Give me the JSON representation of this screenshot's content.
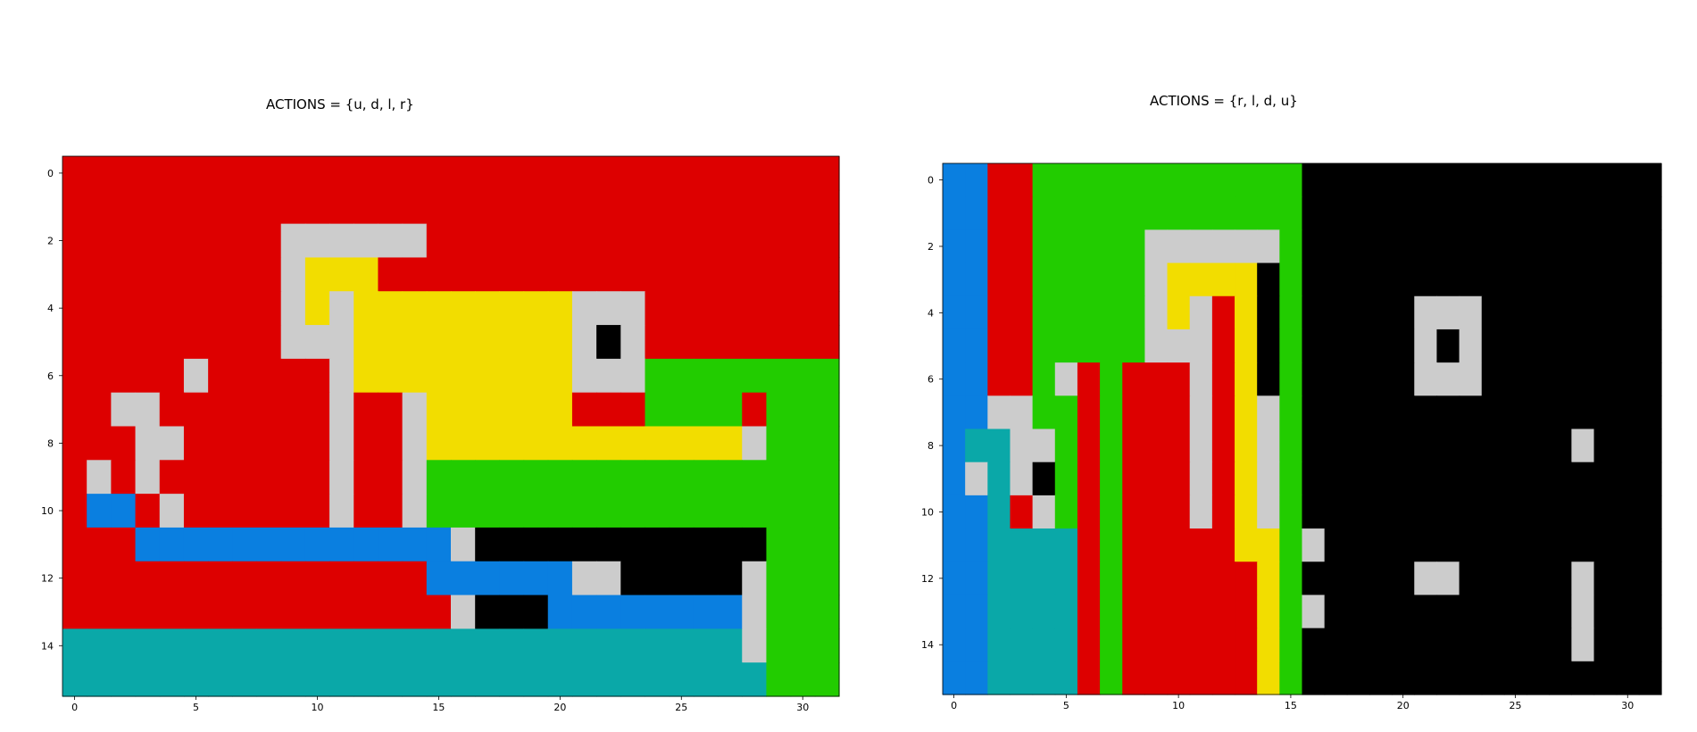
{
  "chart_data": [
    {
      "type": "heatmap",
      "title": "ACTIONS = {u, d, l, r}",
      "grid_shape": [
        16,
        32
      ],
      "xticks": [
        "0",
        "5",
        "10",
        "15",
        "20",
        "25",
        "30"
      ],
      "yticks": [
        "0",
        "2",
        "4",
        "6",
        "8",
        "10",
        "12",
        "14"
      ],
      "grid_rows": [
        "RRRRRRRRRRRRRRRRRRRRRRRRRRRRRRRR",
        "RRRRRRRRRRRRRRRRRRRRRRRRRRRRRRRR",
        "RRRRRRRRRWWWWWWRRRRRRRRRRRRRRRRR",
        "RRRRRRRRRWYYYRRRRRRRRRRRRRRRRRRR",
        "RRRRRRRRRWYWYYYYYYYYYWWWRRRRRRRR",
        "RRRRRRRRRWWWYYYYYYYYYWKWRRRRRRRR",
        "RRRRRWRRRRRWYYYYYYYYYWWWGGGGGGGG",
        "RRWWRRRRRRRWRRWYYYYYYRRRGGGGRGGG",
        "RRRWWRRRRRRWRRWYYYYYYYYYYYYYWGGG",
        "RWRWRRRRRRRWRRWGGGGGGGGGGGGGGGGG",
        "RBBRWRRRRRRWRRWGGGGGGGGGGGGGGGGG",
        "RRRBBBBBBBBBBBBBWKKKKKKKKKKKKGGG",
        "RRRRRRRRRRRRRRRBBBBBBWWKKKKKWGGG",
        "RRRRRRRRRRRRRRRRWKKKBBBBBBBBWGGG",
        "TTTTTTTTTTTTTTTTTTTTTTTTTTTTWGGG",
        "TTTTTTTTTTTTTTTTTTTTTTTTTTTTTGGG"
      ]
    },
    {
      "type": "heatmap",
      "title": "ACTIONS = {r, l, d, u}",
      "grid_shape": [
        16,
        32
      ],
      "xticks": [
        "0",
        "5",
        "10",
        "15",
        "20",
        "25",
        "30"
      ],
      "yticks": [
        "0",
        "2",
        "4",
        "6",
        "8",
        "10",
        "12",
        "14"
      ],
      "grid_rows": [
        "BBRRGGGGGGGGGGGGKKKKKKKKKKKKKKKK",
        "BBRRGGGGGGGGGGGGKKKKKKKKKKKKKKKK",
        "BBRRGGGGGWWWWWWGKKKKKKKKKKKKKKKK",
        "BBRRGGGGGWYYYYKGKKKKKKKKKKKKKKKK",
        "BBRRGGGGGWYWRYKGKKKKKWWWKKKKKKKK",
        "BBRRGGGGGWWWRYKGKKKKKWKWKKKKKKKK",
        "BBRRGWRGRRRWRYKGKKKKKWWWKKKKKKKK",
        "BBWWGGRGRRRWRYWGKKKKKKKKKKKKKKKK",
        "BTTWWGRGRRRWRYWGKKKKKKKKKKKKWKKK",
        "BWTWKGRGRRRWRYWGKKKKKKKKKKKKKKKK",
        "BBTRWGRGRRRWRYWGKKKKKKKKKKKKKKKK",
        "BBTTTTRGRRRRRYYGWKKKKKKKKKKKKKKK",
        "BBTTTTRGRRRRRRYGKKKKKWWKKKKKWKKK",
        "BBTTTTRGRRRRRRYGWKKKKKKKKKKKWKKK",
        "BBTTTTRGRRRRRRYGKKKKKKKKKKKKWKKK",
        "BBTTTTRGRRRRRRYGKKKKKKKKKKKKKKKK"
      ]
    }
  ],
  "palette": {
    "R": "#dd0000",
    "W": "#cccccc",
    "K": "#000000",
    "Y": "#f2dd00",
    "G": "#22cc00",
    "B": "#0a7fe0",
    "T": "#0aa8a8"
  }
}
